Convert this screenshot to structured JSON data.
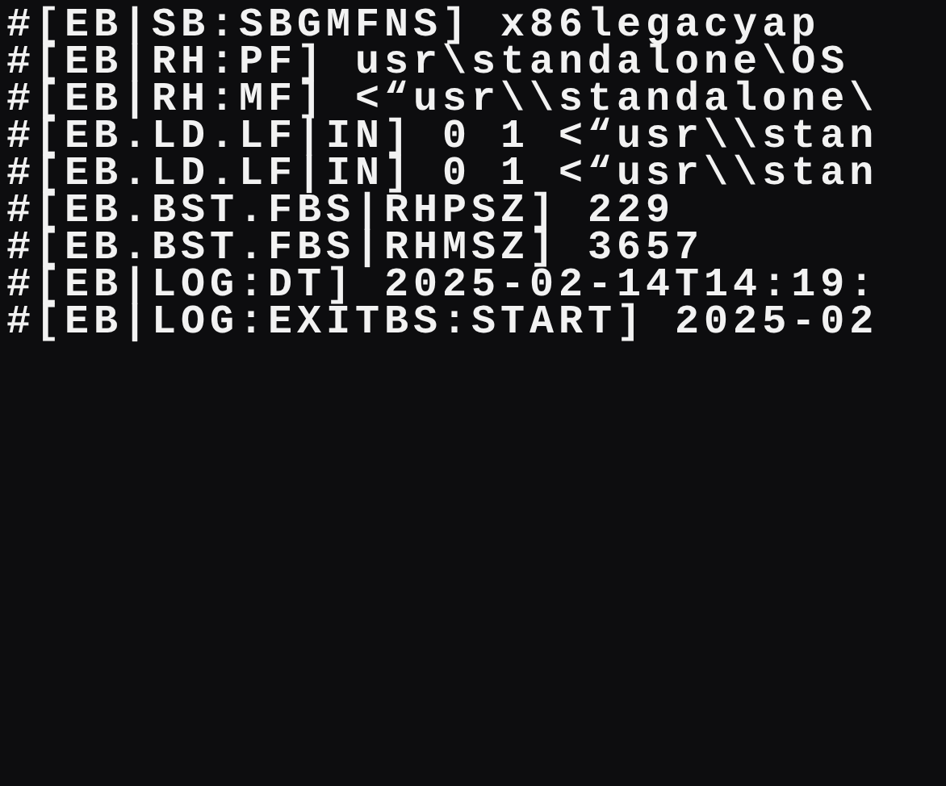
{
  "console": {
    "lines": [
      "#[EB|SB:SBGMFNS] x86legacyap",
      "#[EB|RH:PF] usr\\standalone\\OS",
      "#[EB|RH:MF] <“usr\\\\standalone\\",
      "#[EB.LD.LF|IN] 0 1 <“usr\\\\stan",
      "#[EB.LD.LF|IN] 0 1 <“usr\\\\stan",
      "#[EB.BST.FBS|RHPSZ] 229",
      "#[EB.BST.FBS|RHMSZ] 3657",
      "#[EB|LOG:DT] 2025-02-14T14:19:",
      "#[EB|LOG:EXITBS:START] 2025-02"
    ]
  }
}
